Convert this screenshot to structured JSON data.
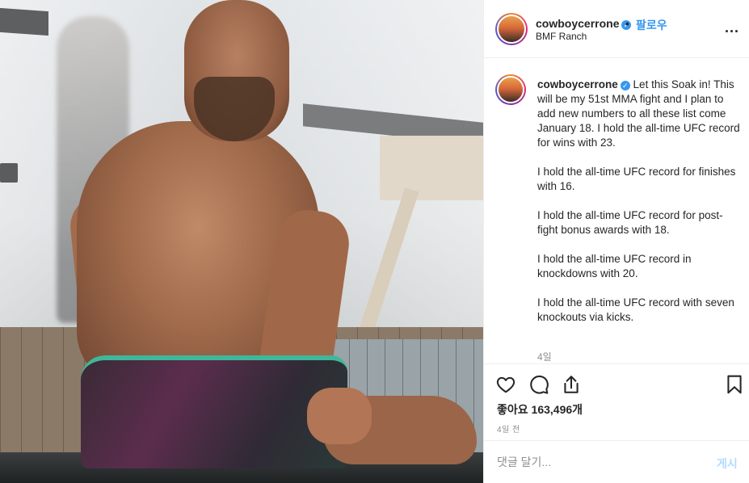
{
  "post": {
    "username": "cowboycerrone",
    "verified": true,
    "follow_label": "팔로우",
    "separator": "•",
    "location": "BMF Ranch",
    "more_icon": "more-horizontal-icon",
    "more_label": "..."
  },
  "caption": {
    "username": "cowboycerrone",
    "lead": "Let this Soak in! This will be my 51st MMA fight and I plan to add new numbers to all these list come January 18. I hold the all-time UFC record for wins with 23.",
    "paragraphs": [
      "I hold the all-time UFC record for finishes with 16.",
      "I hold the all-time UFC record for post-fight bonus awards with 18.",
      "I hold the all-time UFC record in knockdowns with 20.",
      "I hold the all-time UFC record with seven knockouts via kicks."
    ],
    "time_ago": "4일"
  },
  "actions": {
    "like_icon": "heart-icon",
    "comment_icon": "comment-icon",
    "share_icon": "share-icon",
    "save_icon": "bookmark-icon",
    "likes_text": "좋아요 163,496개",
    "date_text": "4일 전"
  },
  "comment": {
    "placeholder": "댓글 달기...",
    "post_label": "게시"
  },
  "colors": {
    "accent": "#3897f0",
    "text": "#262626",
    "muted": "#8e8e8e",
    "post_disabled": "#b3dbff",
    "border": "#efefef"
  }
}
